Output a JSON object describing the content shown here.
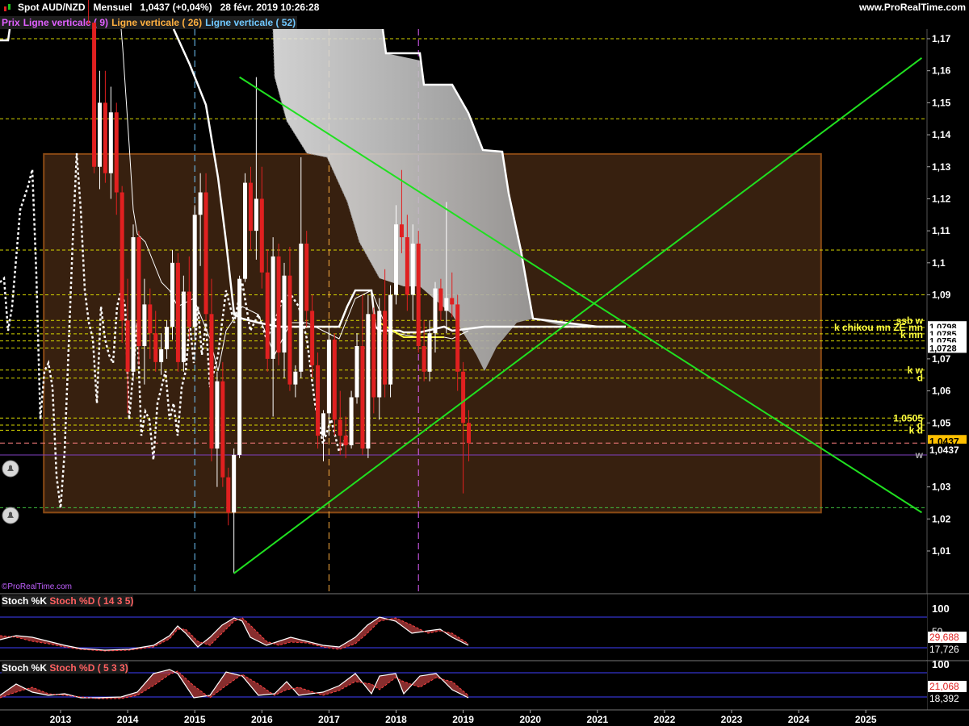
{
  "header": {
    "title": "Spot AUD/NZD   Mensuel   1,0437 (+0,04%)   28 févr. 2019 10:26:28",
    "site": "www.ProRealTime.com"
  },
  "legend": [
    {
      "label": "Prix",
      "color": "#e060ff"
    },
    {
      "label": "Ligne verticale ( 9)",
      "color": "#e060ff"
    },
    {
      "label": "Ligne verticale ( 26)",
      "color": "#ffb040"
    },
    {
      "label": "Ligne verticale ( 52)",
      "color": "#70c8ff"
    }
  ],
  "watermark": "©ProRealTime.com",
  "price_axis": {
    "ticks": [
      "1,17",
      "1,16",
      "1,15",
      "1,14",
      "1,13",
      "1,12",
      "1,11",
      "1,1",
      "1,09",
      "1,07",
      "1,06",
      "1,05",
      "1,03",
      "1,02",
      "1,01"
    ],
    "values": [
      1.17,
      1.16,
      1.15,
      1.14,
      1.13,
      1.12,
      1.11,
      1.1,
      1.09,
      1.07,
      1.06,
      1.05,
      1.03,
      1.02,
      1.01
    ],
    "current_price": "1,0437",
    "current_price_2": "1,0437"
  },
  "level_labels": [
    {
      "text": "ssb w",
      "value": 1.082,
      "color": "#ffff40"
    },
    {
      "text": "k chikou mn ZE mn",
      "value": 1.0798,
      "color": "#ffff40"
    },
    {
      "text": "k mn",
      "value": 1.0775,
      "color": "#ffff40"
    },
    {
      "text": "k w",
      "value": 1.0665,
      "color": "#ffff40"
    },
    {
      "text": "d",
      "value": 1.064,
      "color": "#ffff40"
    },
    {
      "text": "1,0505",
      "value": 1.0515,
      "color": "#ffff40"
    },
    {
      "text": "d",
      "value": 1.0493,
      "color": "#ffff40"
    },
    {
      "text": "k d",
      "value": 1.0477,
      "color": "#ffff40"
    },
    {
      "text": "w",
      "value": 1.04,
      "color": "#aaaaaa"
    }
  ],
  "level_boxes": [
    {
      "text": "1,0798",
      "value": 1.08
    },
    {
      "text": "1,0785",
      "value": 1.0778
    },
    {
      "text": "1,0756",
      "value": 1.0756
    },
    {
      "text": "1,0728",
      "value": 1.0734
    }
  ],
  "time_axis": {
    "labels": [
      "2013",
      "2014",
      "2015",
      "2016",
      "2017",
      "2018",
      "2019",
      "2020",
      "2021",
      "2022",
      "2023",
      "2024",
      "2025"
    ]
  },
  "stoch1": {
    "label_k": "Stoch %K",
    "label_d": "Stoch %D ( 14 3 5)",
    "ticks": [
      "100",
      "50"
    ],
    "value_d": "29,688",
    "value_k": "17,726"
  },
  "stoch2": {
    "label_k": "Stoch %K",
    "label_d": "Stoch %D ( 5 3 3)",
    "ticks": [
      "100",
      "50"
    ],
    "value_d": "21,068",
    "value_k": "18,392"
  },
  "chart_data": {
    "type": "candlestick",
    "title": "Spot AUD/NZD Mensuel",
    "ylim": [
      1.003,
      1.175
    ],
    "x_range": [
      "2012-06",
      "2025-12"
    ],
    "candles": [
      {
        "t": "2013-06",
        "o": 1.245,
        "h": 1.255,
        "l": 1.185,
        "c": 1.19
      },
      {
        "t": "2013-07",
        "o": 1.19,
        "h": 1.2,
        "l": 1.128,
        "c": 1.13
      },
      {
        "t": "2013-08",
        "o": 1.13,
        "h": 1.16,
        "l": 1.123,
        "c": 1.15
      },
      {
        "t": "2013-09",
        "o": 1.15,
        "h": 1.16,
        "l": 1.125,
        "c": 1.128
      },
      {
        "t": "2013-10",
        "o": 1.128,
        "h": 1.155,
        "l": 1.12,
        "c": 1.147
      },
      {
        "t": "2013-11",
        "o": 1.147,
        "h": 1.15,
        "l": 1.115,
        "c": 1.122
      },
      {
        "t": "2013-12",
        "o": 1.122,
        "h": 1.124,
        "l": 1.075,
        "c": 1.082
      },
      {
        "t": "2014-01",
        "o": 1.082,
        "h": 1.095,
        "l": 1.053,
        "c": 1.066
      },
      {
        "t": "2014-02",
        "o": 1.066,
        "h": 1.112,
        "l": 1.063,
        "c": 1.108
      },
      {
        "t": "2014-03",
        "o": 1.108,
        "h": 1.11,
        "l": 1.068,
        "c": 1.074
      },
      {
        "t": "2014-04",
        "o": 1.074,
        "h": 1.095,
        "l": 1.062,
        "c": 1.087
      },
      {
        "t": "2014-05",
        "o": 1.087,
        "h": 1.092,
        "l": 1.07,
        "c": 1.078
      },
      {
        "t": "2014-06",
        "o": 1.078,
        "h": 1.085,
        "l": 1.066,
        "c": 1.069
      },
      {
        "t": "2014-07",
        "o": 1.069,
        "h": 1.078,
        "l": 1.065,
        "c": 1.073
      },
      {
        "t": "2014-08",
        "o": 1.073,
        "h": 1.082,
        "l": 1.07,
        "c": 1.08
      },
      {
        "t": "2014-09",
        "o": 1.08,
        "h": 1.104,
        "l": 1.076,
        "c": 1.1
      },
      {
        "t": "2014-10",
        "o": 1.1,
        "h": 1.103,
        "l": 1.066,
        "c": 1.069
      },
      {
        "t": "2014-11",
        "o": 1.069,
        "h": 1.096,
        "l": 1.066,
        "c": 1.091
      },
      {
        "t": "2014-12",
        "o": 1.091,
        "h": 1.102,
        "l": 1.076,
        "c": 1.08
      },
      {
        "t": "2015-01",
        "o": 1.08,
        "h": 1.118,
        "l": 1.077,
        "c": 1.115
      },
      {
        "t": "2015-02",
        "o": 1.115,
        "h": 1.128,
        "l": 1.099,
        "c": 1.122
      },
      {
        "t": "2015-03",
        "o": 1.122,
        "h": 1.128,
        "l": 1.082,
        "c": 1.084
      },
      {
        "t": "2015-04",
        "o": 1.084,
        "h": 1.095,
        "l": 1.038,
        "c": 1.042
      },
      {
        "t": "2015-05",
        "o": 1.042,
        "h": 1.066,
        "l": 1.03,
        "c": 1.063
      },
      {
        "t": "2015-06",
        "o": 1.063,
        "h": 1.069,
        "l": 1.03,
        "c": 1.033
      },
      {
        "t": "2015-07",
        "o": 1.033,
        "h": 1.036,
        "l": 1.018,
        "c": 1.022
      },
      {
        "t": "2015-08",
        "o": 1.022,
        "h": 1.042,
        "l": 1.003,
        "c": 1.04
      },
      {
        "t": "2015-09",
        "o": 1.04,
        "h": 1.096,
        "l": 1.039,
        "c": 1.095
      },
      {
        "t": "2015-10",
        "o": 1.095,
        "h": 1.128,
        "l": 1.094,
        "c": 1.125
      },
      {
        "t": "2015-11",
        "o": 1.125,
        "h": 1.13,
        "l": 1.104,
        "c": 1.11
      },
      {
        "t": "2015-12",
        "o": 1.11,
        "h": 1.158,
        "l": 1.101,
        "c": 1.12
      },
      {
        "t": "2016-01",
        "o": 1.12,
        "h": 1.13,
        "l": 1.092,
        "c": 1.097
      },
      {
        "t": "2016-02",
        "o": 1.097,
        "h": 1.104,
        "l": 1.066,
        "c": 1.07
      },
      {
        "t": "2016-03",
        "o": 1.07,
        "h": 1.108,
        "l": 1.052,
        "c": 1.102
      },
      {
        "t": "2016-04",
        "o": 1.102,
        "h": 1.106,
        "l": 1.068,
        "c": 1.072
      },
      {
        "t": "2016-05",
        "o": 1.072,
        "h": 1.1,
        "l": 1.064,
        "c": 1.096
      },
      {
        "t": "2016-06",
        "o": 1.096,
        "h": 1.105,
        "l": 1.06,
        "c": 1.062
      },
      {
        "t": "2016-07",
        "o": 1.062,
        "h": 1.068,
        "l": 1.058,
        "c": 1.066
      },
      {
        "t": "2016-08",
        "o": 1.066,
        "h": 1.133,
        "l": 1.064,
        "c": 1.106
      },
      {
        "t": "2016-09",
        "o": 1.106,
        "h": 1.11,
        "l": 1.08,
        "c": 1.085
      },
      {
        "t": "2016-10",
        "o": 1.085,
        "h": 1.09,
        "l": 1.064,
        "c": 1.068
      },
      {
        "t": "2016-11",
        "o": 1.068,
        "h": 1.072,
        "l": 1.042,
        "c": 1.046
      },
      {
        "t": "2016-12",
        "o": 1.046,
        "h": 1.054,
        "l": 1.038,
        "c": 1.053
      },
      {
        "t": "2017-01",
        "o": 1.053,
        "h": 1.08,
        "l": 1.046,
        "c": 1.076
      },
      {
        "t": "2017-02",
        "o": 1.076,
        "h": 1.078,
        "l": 1.046,
        "c": 1.051
      },
      {
        "t": "2017-03",
        "o": 1.051,
        "h": 1.06,
        "l": 1.04,
        "c": 1.046
      },
      {
        "t": "2017-04",
        "o": 1.046,
        "h": 1.052,
        "l": 1.039,
        "c": 1.043
      },
      {
        "t": "2017-05",
        "o": 1.043,
        "h": 1.06,
        "l": 1.042,
        "c": 1.058
      },
      {
        "t": "2017-06",
        "o": 1.058,
        "h": 1.078,
        "l": 1.056,
        "c": 1.074
      },
      {
        "t": "2017-07",
        "o": 1.074,
        "h": 1.09,
        "l": 1.04,
        "c": 1.042
      },
      {
        "t": "2017-08",
        "o": 1.042,
        "h": 1.09,
        "l": 1.039,
        "c": 1.084
      },
      {
        "t": "2017-09",
        "o": 1.084,
        "h": 1.086,
        "l": 1.053,
        "c": 1.058
      },
      {
        "t": "2017-10",
        "o": 1.058,
        "h": 1.089,
        "l": 1.051,
        "c": 1.085
      },
      {
        "t": "2017-11",
        "o": 1.085,
        "h": 1.098,
        "l": 1.058,
        "c": 1.062
      },
      {
        "t": "2017-12",
        "o": 1.062,
        "h": 1.093,
        "l": 1.058,
        "c": 1.09
      },
      {
        "t": "2018-01",
        "o": 1.09,
        "h": 1.118,
        "l": 1.087,
        "c": 1.112
      },
      {
        "t": "2018-02",
        "o": 1.112,
        "h": 1.129,
        "l": 1.103,
        "c": 1.108
      },
      {
        "t": "2018-03",
        "o": 1.108,
        "h": 1.115,
        "l": 1.085,
        "c": 1.09
      },
      {
        "t": "2018-04",
        "o": 1.09,
        "h": 1.112,
        "l": 1.082,
        "c": 1.106
      },
      {
        "t": "2018-05",
        "o": 1.106,
        "h": 1.11,
        "l": 1.072,
        "c": 1.074
      },
      {
        "t": "2018-06",
        "o": 1.074,
        "h": 1.082,
        "l": 1.063,
        "c": 1.066
      },
      {
        "t": "2018-07",
        "o": 1.066,
        "h": 1.082,
        "l": 1.063,
        "c": 1.078
      },
      {
        "t": "2018-08",
        "o": 1.078,
        "h": 1.094,
        "l": 1.072,
        "c": 1.092
      },
      {
        "t": "2018-09",
        "o": 1.092,
        "h": 1.095,
        "l": 1.082,
        "c": 1.085
      },
      {
        "t": "2018-10",
        "o": 1.085,
        "h": 1.119,
        "l": 1.078,
        "c": 1.089
      },
      {
        "t": "2018-11",
        "o": 1.089,
        "h": 1.097,
        "l": 1.083,
        "c": 1.087
      },
      {
        "t": "2018-12",
        "o": 1.087,
        "h": 1.09,
        "l": 1.06,
        "c": 1.066
      },
      {
        "t": "2019-01",
        "o": 1.066,
        "h": 1.069,
        "l": 1.028,
        "c": 1.05
      },
      {
        "t": "2019-02",
        "o": 1.05,
        "h": 1.054,
        "l": 1.038,
        "c": 1.0437
      }
    ],
    "horizontal_levels": [
      1.17,
      1.145,
      1.104,
      1.09,
      1.082,
      1.0798,
      1.0778,
      1.0756,
      1.0734,
      1.0665,
      1.064,
      1.0515,
      1.0493,
      1.0477,
      1.04,
      1.0235
    ],
    "rectangle": {
      "t_start": "2012-10",
      "t_end": "2024-05",
      "y_top": 1.134,
      "y_bottom": 1.022
    },
    "trendlines": [
      {
        "t1": "2015-08",
        "y1": 1.003,
        "t2": "2025-11",
        "y2": 1.164
      },
      {
        "t1": "2015-09",
        "y1": 1.158,
        "t2": "2025-11",
        "y2": 1.022
      }
    ],
    "vertical_lines": [
      {
        "t": "2015-01",
        "label": "Ligne verticale ( 52)",
        "color": "#70c8ff"
      },
      {
        "t": "2017-01",
        "label": "Ligne verticale ( 26)",
        "color": "#ffb040"
      },
      {
        "t": "2018-05",
        "label": "Ligne verticale ( 9)",
        "color": "#e060ff"
      }
    ]
  }
}
